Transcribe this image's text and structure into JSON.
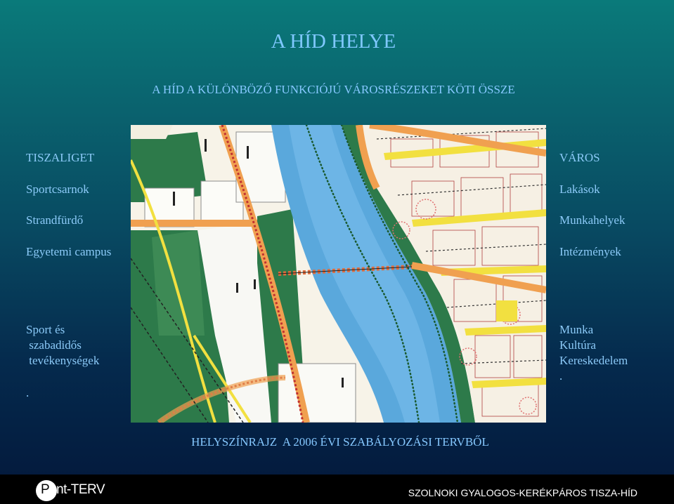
{
  "slide": {
    "title": "A HÍD HELYE",
    "subtitle": "A HÍD A KÜLÖNBÖZŐ FUNKCIÓJÚ VÁROSRÉSZEKET KÖTI ÖSSZE",
    "caption": "HELYSZÍNRAJZ  A 2006 ÉVI SZABÁLYOZÁSI TERVBŐL"
  },
  "left_column": {
    "heading": "TISZALIGET",
    "items": [
      "Sportcsarnok",
      "Strandfürdő",
      "Egyetemi campus"
    ],
    "lower_lines": [
      "Sport és",
      " szabadidős",
      " tevékenységek"
    ],
    "trailing_mark": "."
  },
  "right_column": {
    "heading": "VÁROS",
    "items": [
      "Lakások",
      "Munkahelyek",
      "Intézmények"
    ],
    "lower_lines": [
      "Munka",
      "Kultúra",
      "Kereskedelem"
    ],
    "trailing_mark": "."
  },
  "footer": {
    "logo_letter": "P",
    "logo_rest": "ont-TERV",
    "text": "SZOLNOKI GYALOGOS-KERÉKPÁROS TISZA-HÍD"
  },
  "colors": {
    "river": "#5aa8dc",
    "green_zone": "#2d7a4a",
    "road": "#f0a050",
    "yellow_road": "#f2e040",
    "bridge": "#e06a3a"
  }
}
